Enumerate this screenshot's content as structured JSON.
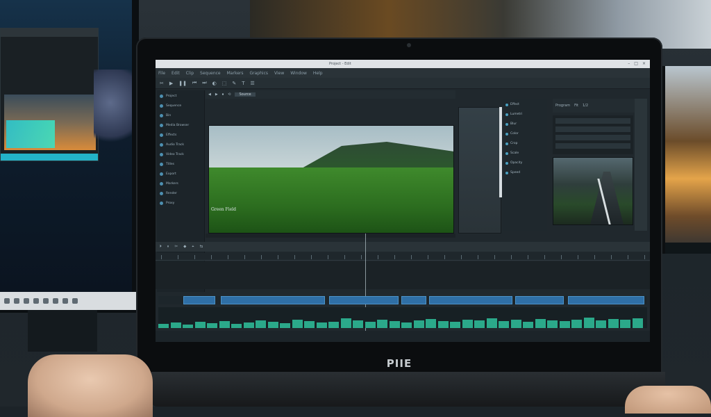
{
  "titlebar": {
    "title": "Project - Edit",
    "controls": [
      "–",
      "□",
      "×"
    ]
  },
  "menubar": {
    "items": [
      "File",
      "Edit",
      "Clip",
      "Sequence",
      "Markers",
      "Graphics",
      "View",
      "Window",
      "Help"
    ]
  },
  "toolbar": {
    "items": [
      "✂",
      "▶",
      "❚❚",
      "⏮",
      "⏭",
      "◐",
      "⬚",
      "✎",
      "T",
      "☰"
    ]
  },
  "project_panel": {
    "items": [
      "Project",
      "Sequence",
      "Bin",
      "Media Browser",
      "Effects",
      "Audio Track",
      "Video Track",
      "Titles",
      "Export",
      "Markers",
      "Render",
      "Proxy"
    ]
  },
  "viewer": {
    "header_items": [
      "◀",
      "▶",
      "⏹",
      "⟲"
    ],
    "clip_name": "Source",
    "caption": "Green Field"
  },
  "effects_panel": {
    "items": [
      "Effect",
      "Lumetri",
      "Blur",
      "Color",
      "Crop",
      "Scale",
      "Opacity",
      "Speed"
    ]
  },
  "program_panel": {
    "header_items": [
      "Program",
      "Fit",
      "1/2"
    ]
  },
  "timeline": {
    "toolbar_items": [
      "⏵",
      "⏸",
      "✂",
      "◆",
      "⌖",
      "⇆"
    ]
  },
  "laptop": {
    "brand": "PIIE"
  },
  "colors": {
    "accent": "#2f6fa6",
    "audio": "#2ba98a",
    "background": "#20282d"
  }
}
